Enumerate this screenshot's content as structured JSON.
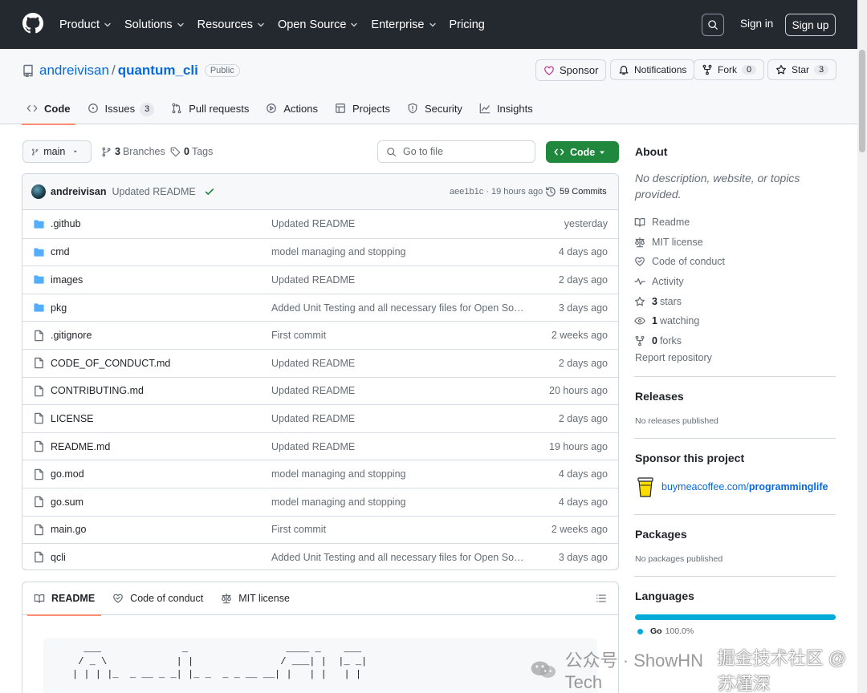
{
  "header": {
    "nav": [
      "Product",
      "Solutions",
      "Resources",
      "Open Source",
      "Enterprise",
      "Pricing"
    ],
    "nav_has_dropdown": [
      true,
      true,
      true,
      true,
      true,
      false
    ],
    "sign_in": "Sign in",
    "sign_up": "Sign up"
  },
  "repo": {
    "owner": "andreivisan",
    "separator": "/",
    "name": "quantum_cli",
    "visibility": "Public",
    "sponsor": "Sponsor",
    "notifications": "Notifications",
    "fork_label": "Fork",
    "fork_count": "0",
    "star_label": "Star",
    "star_count": "3"
  },
  "tabs": [
    {
      "label": "Code",
      "icon": "code-icon",
      "active": true
    },
    {
      "label": "Issues",
      "icon": "issue-icon",
      "count": "3"
    },
    {
      "label": "Pull requests",
      "icon": "pull-request-icon"
    },
    {
      "label": "Actions",
      "icon": "play-icon"
    },
    {
      "label": "Projects",
      "icon": "table-icon"
    },
    {
      "label": "Security",
      "icon": "shield-icon"
    },
    {
      "label": "Insights",
      "icon": "graph-icon"
    }
  ],
  "toolbar": {
    "branch": "main",
    "branches_count": "3",
    "branches_label": "Branches",
    "tags_count": "0",
    "tags_label": "Tags",
    "goto_placeholder": "Go to file",
    "code_button": "Code"
  },
  "latest_commit": {
    "author": "andreivisan",
    "message": "Updated README",
    "sha_time": "aee1b1c · 19 hours ago",
    "commits": "59 Commits"
  },
  "files": [
    {
      "type": "dir",
      "name": ".github",
      "message": "Updated README",
      "date": "yesterday"
    },
    {
      "type": "dir",
      "name": "cmd",
      "message": "model managing and stopping",
      "date": "4 days ago"
    },
    {
      "type": "dir",
      "name": "images",
      "message": "Updated README",
      "date": "2 days ago"
    },
    {
      "type": "dir",
      "name": "pkg",
      "message": "Added Unit Testing and all necessary files for Open Sourc…",
      "date": "3 days ago"
    },
    {
      "type": "file",
      "name": ".gitignore",
      "message": "First commit",
      "date": "2 weeks ago"
    },
    {
      "type": "file",
      "name": "CODE_OF_CONDUCT.md",
      "message": "Updated README",
      "date": "2 days ago"
    },
    {
      "type": "file",
      "name": "CONTRIBUTING.md",
      "message": "Updated README",
      "date": "20 hours ago"
    },
    {
      "type": "file",
      "name": "LICENSE",
      "message": "Updated README",
      "date": "2 days ago"
    },
    {
      "type": "file",
      "name": "README.md",
      "message": "Updated README",
      "date": "19 hours ago"
    },
    {
      "type": "file",
      "name": "go.mod",
      "message": "model managing and stopping",
      "date": "4 days ago"
    },
    {
      "type": "file",
      "name": "go.sum",
      "message": "model managing and stopping",
      "date": "4 days ago"
    },
    {
      "type": "file",
      "name": "main.go",
      "message": "First commit",
      "date": "2 weeks ago"
    },
    {
      "type": "file",
      "name": "qcli",
      "message": "Added Unit Testing and all necessary files for Open Sourc…",
      "date": "3 days ago"
    }
  ],
  "readme": {
    "tabs": [
      "README",
      "Code of conduct",
      "MIT license"
    ],
    "ascii": "  ___              _                 ____ _    ___\n / _ \\            | |               / ___| |  |_ _|\n| | | |_  _ __ _ _| |_ _  _ _ __ __| |   | |   | |"
  },
  "about": {
    "title": "About",
    "description": "No description, website, or topics provided.",
    "links": [
      {
        "icon": "book-icon",
        "label": "Readme"
      },
      {
        "icon": "law-icon",
        "label": "MIT license"
      },
      {
        "icon": "code-of-conduct-icon",
        "label": "Code of conduct"
      },
      {
        "icon": "pulse-icon",
        "label": "Activity"
      },
      {
        "icon": "star-icon",
        "bold": "3",
        "label": "stars"
      },
      {
        "icon": "eye-icon",
        "bold": "1",
        "label": "watching"
      },
      {
        "icon": "fork-icon",
        "bold": "0",
        "label": "forks"
      }
    ],
    "report": "Report repository"
  },
  "releases": {
    "title": "Releases",
    "note": "No releases published"
  },
  "sponsor_project": {
    "title": "Sponsor this project",
    "link_domain": "buymeacoffee.com/",
    "link_user": "programminglife"
  },
  "packages": {
    "title": "Packages",
    "note": "No packages published"
  },
  "languages": {
    "title": "Languages",
    "items": [
      {
        "name": "Go",
        "percent": "100.0%",
        "color": "#00acd7"
      }
    ]
  },
  "watermark": {
    "channel": "公众号 · ShowHN Tech",
    "site": "掘金技术社区 @ 苏槿深"
  },
  "colors": {
    "header_bg": "#24292f",
    "accent": "#0969da",
    "code_button": "#1f883d",
    "tab_underline": "#fd8c73"
  }
}
